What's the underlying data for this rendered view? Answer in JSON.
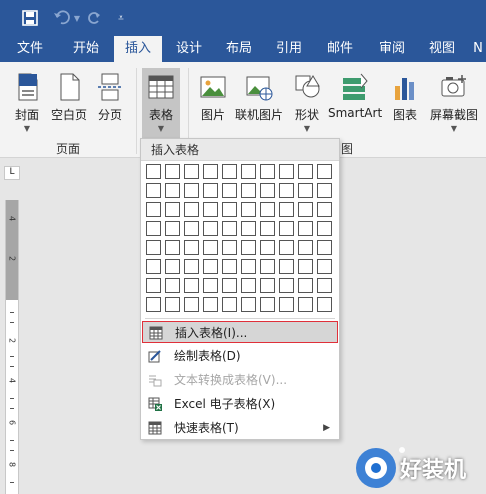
{
  "window": {
    "quick_access": [
      "save-icon",
      "undo-icon",
      "redo-icon",
      "customize-dropdown-icon"
    ]
  },
  "tabs": [
    {
      "label": "文件",
      "active": false
    },
    {
      "label": "开始",
      "active": false
    },
    {
      "label": "插入",
      "active": true
    },
    {
      "label": "设计",
      "active": false
    },
    {
      "label": "布局",
      "active": false
    },
    {
      "label": "引用",
      "active": false
    },
    {
      "label": "邮件",
      "active": false
    },
    {
      "label": "审阅",
      "active": false
    },
    {
      "label": "视图",
      "active": false
    },
    {
      "label": "N",
      "active": false
    }
  ],
  "ribbon": {
    "buttons": {
      "cover": "封面",
      "blank_page": "空白页",
      "page_break": "分页",
      "table": "表格",
      "picture": "图片",
      "online_picture": "联机图片",
      "shapes": "形状",
      "smartart": "SmartArt",
      "chart": "图表",
      "screenshot": "屏幕截图"
    },
    "groups": {
      "pages": "页面",
      "illustrations_tail": "图"
    }
  },
  "ruler": {
    "corner": "L",
    "numbers": [
      "4",
      "2",
      "2",
      "4",
      "6",
      "8"
    ]
  },
  "dropdown": {
    "header": "插入表格",
    "grid": {
      "columns": 10,
      "rows": 8
    },
    "items": [
      {
        "label": "插入表格(I)...",
        "icon": "insert-table-icon",
        "highlighted": true,
        "disabled": false,
        "submenu": false
      },
      {
        "label": "绘制表格(D)",
        "icon": "draw-table-icon",
        "highlighted": false,
        "disabled": false,
        "submenu": false
      },
      {
        "label": "文本转换成表格(V)...",
        "icon": "text-to-table-icon",
        "highlighted": false,
        "disabled": true,
        "submenu": false
      },
      {
        "label": "Excel 电子表格(X)",
        "icon": "excel-spreadsheet-icon",
        "highlighted": false,
        "disabled": false,
        "submenu": false
      },
      {
        "label": "快速表格(T)",
        "icon": "quick-tables-icon",
        "highlighted": false,
        "disabled": false,
        "submenu": true
      }
    ]
  },
  "watermark": {
    "text": "好装机"
  },
  "colors": {
    "accent": "#2b579a",
    "highlight_border": "#e0303a",
    "ribbon_bg": "#f3f3f3",
    "doc_bg": "#e6e6e6"
  }
}
